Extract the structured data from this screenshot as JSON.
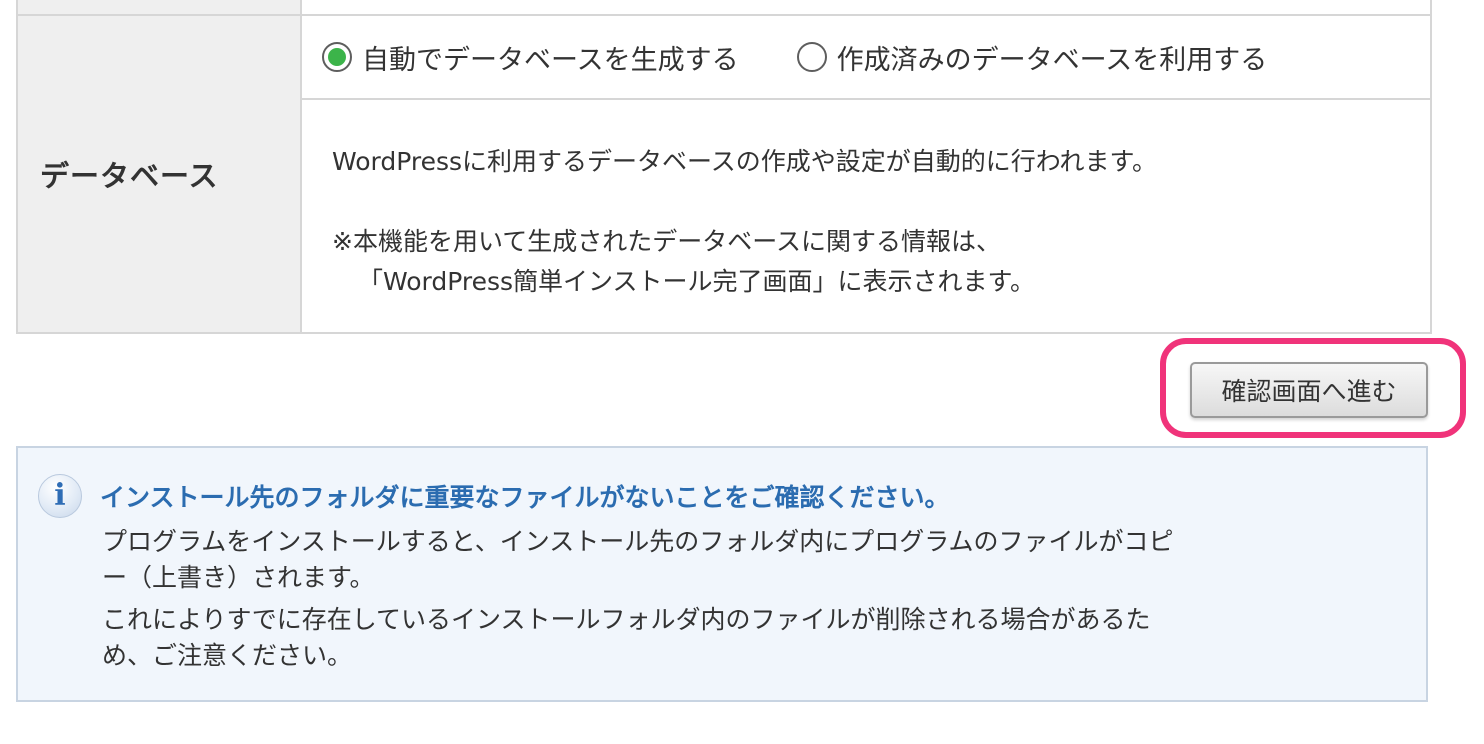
{
  "database_section": {
    "label": "データベース",
    "radio_options": [
      {
        "label": "自動でデータベースを生成する",
        "selected": true
      },
      {
        "label": "作成済みのデータベースを利用する",
        "selected": false
      }
    ],
    "description": "WordPressに利用するデータベースの作成や設定が自動的に行われます。",
    "note_line1": "※本機能を用いて生成されたデータベースに関する情報は、",
    "note_line2": "「WordPress簡単インストール完了画面」に表示されます。"
  },
  "confirm_button": {
    "label": "確認画面へ進む"
  },
  "info_box": {
    "icon_glyph": "i",
    "title": "インストール先のフォルダに重要なファイルがないことをご確認ください。",
    "paragraph1_line1": "プログラムをインストールすると、インストール先のフォルダ内にプログラムのファイルがコピ",
    "paragraph1_line2": "ー（上書き）されます。",
    "paragraph2_line1": "これによりすでに存在しているインストールフォルダ内のファイルが削除される場合があるた",
    "paragraph2_line2": "め、ご注意ください。"
  },
  "colors": {
    "radio_selected": "#3cb44a",
    "highlight_border": "#f0337a",
    "info_title": "#2b6cb0",
    "info_background": "#f1f6fc",
    "label_background": "#efefef"
  }
}
